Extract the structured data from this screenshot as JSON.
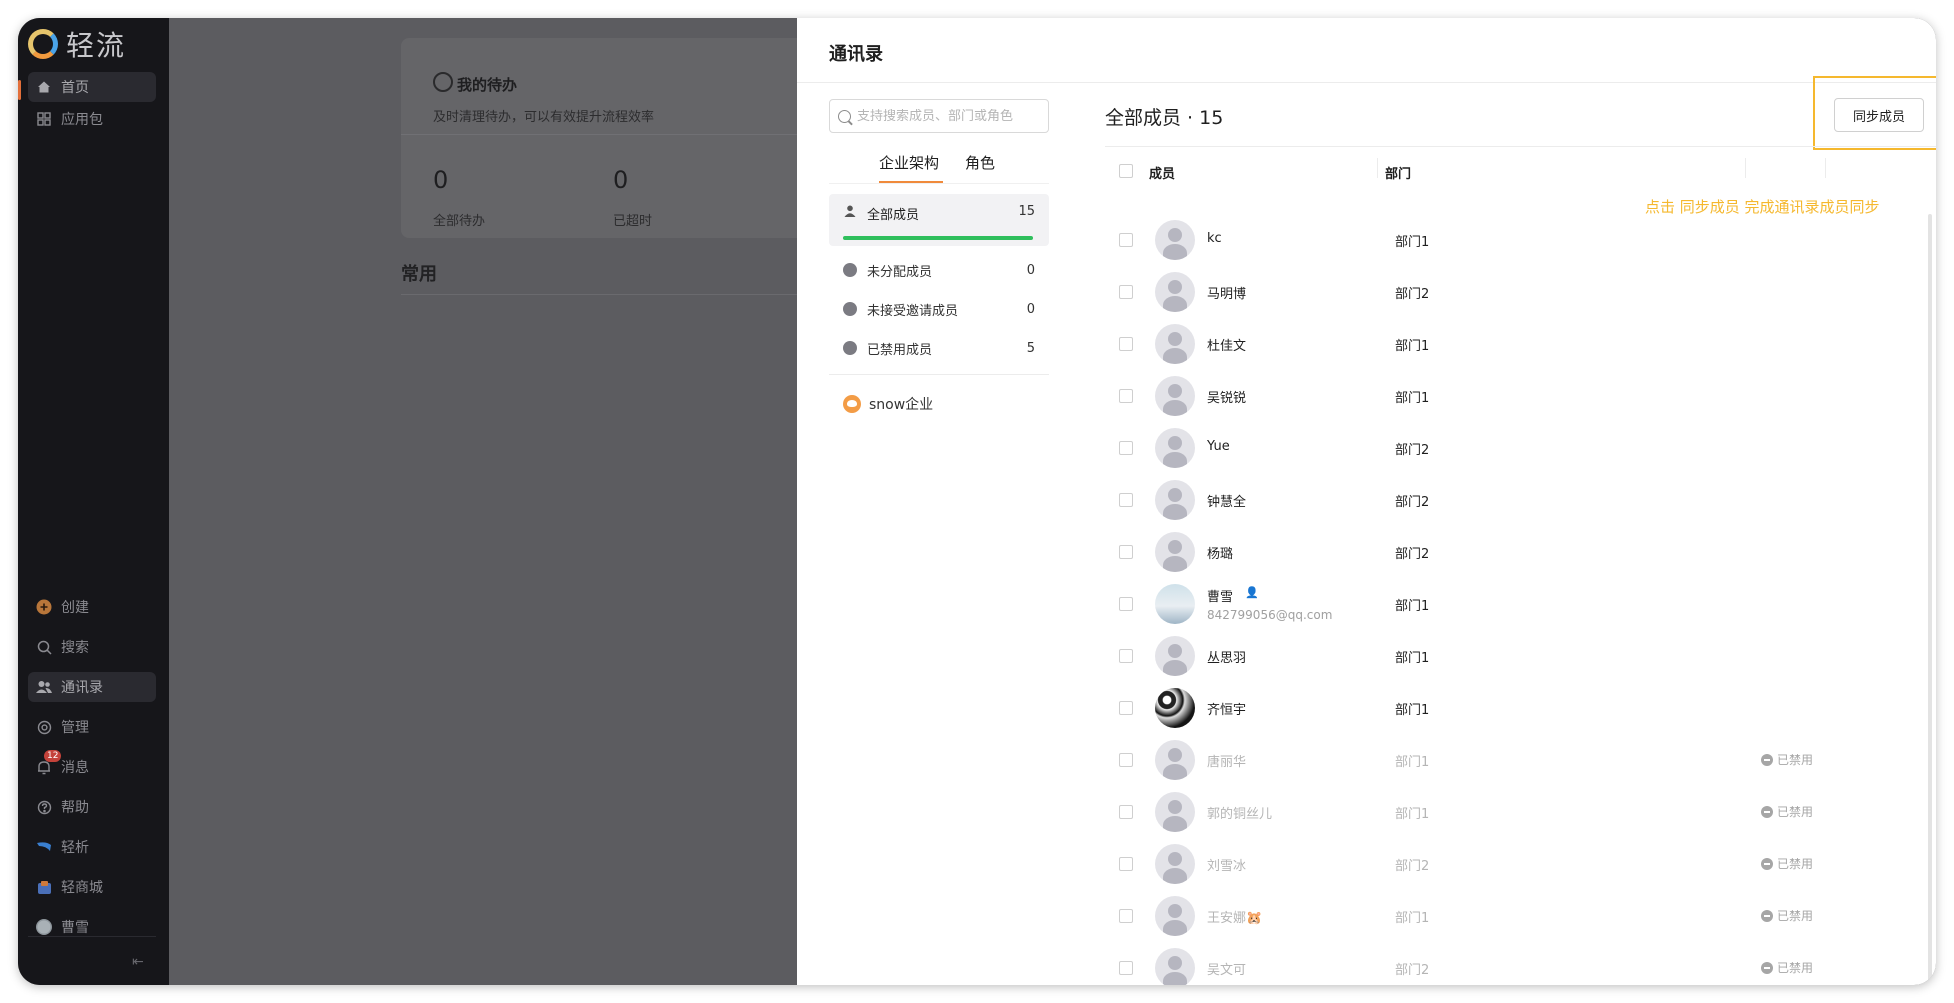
{
  "sidebar": {
    "app_name": "轻流",
    "top_items": [
      {
        "label": "首页",
        "icon": "home-icon"
      },
      {
        "label": "应用包",
        "icon": "grid-icon"
      }
    ],
    "bottom_items": [
      {
        "label": "创建",
        "icon": "plus-icon"
      },
      {
        "label": "搜索",
        "icon": "search-icon"
      },
      {
        "label": "通讯录",
        "icon": "contacts-icon"
      },
      {
        "label": "管理",
        "icon": "settings-icon"
      },
      {
        "label": "消息",
        "icon": "bell-icon",
        "badge": "12"
      },
      {
        "label": "帮助",
        "icon": "help-icon"
      },
      {
        "label": "轻析",
        "icon": "analytics-icon"
      },
      {
        "label": "轻商城",
        "icon": "store-icon"
      },
      {
        "label": "曹雪",
        "icon": "avatar"
      }
    ],
    "collapse_glyph": "⇤"
  },
  "dashboard": {
    "todo_title": "我的待办",
    "todo_sub": "及时清理待办，可以有效提升流程效率",
    "stats": [
      {
        "value": "0",
        "label": "全部待办"
      },
      {
        "value": "0",
        "label": "已超时"
      }
    ],
    "common": "常用"
  },
  "panel": {
    "title": "通讯录",
    "search_placeholder": "支持搜索成员、部门或角色",
    "tabs": [
      "企业架构",
      "角色"
    ],
    "tree": [
      {
        "label": "全部成员",
        "count": "15"
      },
      {
        "label": "未分配成员",
        "count": "0"
      },
      {
        "label": "未接受邀请成员",
        "count": "0"
      },
      {
        "label": "已禁用成员",
        "count": "5"
      }
    ],
    "org": "snow企业",
    "members_title": "全部成员 · 15",
    "sync_button": "同步成员",
    "hint": "点击 同步成员 完成通讯录成员同步",
    "columns": {
      "member": "成员",
      "dept": "部门"
    },
    "members": [
      {
        "name": "kc",
        "dept": "部门1"
      },
      {
        "name": "马明博",
        "dept": "部门2"
      },
      {
        "name": "杜佳文",
        "dept": "部门1"
      },
      {
        "name": "吴锐锐",
        "dept": "部门1"
      },
      {
        "name": "Yue",
        "dept": "部门2"
      },
      {
        "name": "钟慧全",
        "dept": "部门2"
      },
      {
        "name": "杨璐",
        "dept": "部门2"
      },
      {
        "name": "曹雪",
        "dept": "部门1",
        "email": "842799056@qq.com"
      },
      {
        "name": "丛思羽",
        "dept": "部门1"
      },
      {
        "name": "齐恒宇",
        "dept": "部门1"
      },
      {
        "name": "唐丽华",
        "dept": "部门1",
        "status": "已禁用"
      },
      {
        "name": "郭的铜丝儿",
        "dept": "部门1",
        "status": "已禁用"
      },
      {
        "name": "刘雪冰",
        "dept": "部门2",
        "status": "已禁用"
      },
      {
        "name": "王安娜🐹",
        "dept": "部门1",
        "status": "已禁用"
      },
      {
        "name": "吴文可",
        "dept": "部门2",
        "status": "已禁用"
      }
    ]
  },
  "colors": {
    "accent": "#f08a3b",
    "progress": "#2fbf5c",
    "highlight": "#f5b82e"
  }
}
